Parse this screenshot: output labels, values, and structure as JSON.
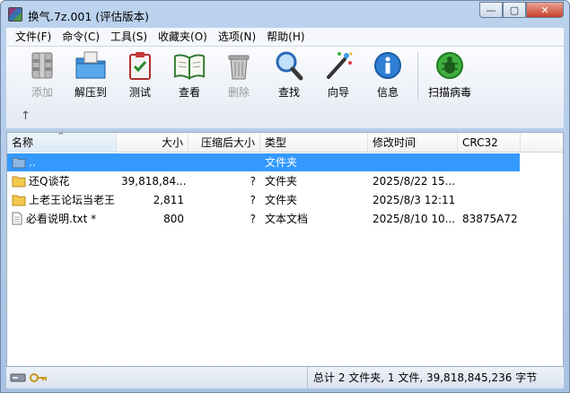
{
  "window": {
    "title": "换气.7z.001 (评估版本)",
    "buttons": {
      "minimize": "—",
      "maximize": "▢",
      "close": "✕"
    }
  },
  "menu": [
    "文件(F)",
    "命令(C)",
    "工具(S)",
    "收藏夹(O)",
    "选项(N)",
    "帮助(H)"
  ],
  "toolbar": {
    "add": "添加",
    "extract": "解压到",
    "test": "测试",
    "view": "查看",
    "delete": "删除",
    "find": "查找",
    "wizard": "向导",
    "info": "信息",
    "virus": "扫描病毒",
    "up_arrow": "↑"
  },
  "list": {
    "headers": {
      "name": "名称",
      "size": "大小",
      "packed": "压缩后大小",
      "type": "类型",
      "modified": "修改时间",
      "crc": "CRC32"
    },
    "sort_indicator": "^",
    "rows": [
      {
        "name": "..",
        "size": "",
        "packed": "",
        "type": "文件夹",
        "modified": "",
        "crc": "",
        "icon": "folder-up",
        "selected": true
      },
      {
        "name": "还Q谈花",
        "size": "39,818,84...",
        "packed": "?",
        "type": "文件夹",
        "modified": "2025/8/22 15...",
        "crc": "",
        "icon": "folder"
      },
      {
        "name": "上老王论坛当老王",
        "size": "2,811",
        "packed": "?",
        "type": "文件夹",
        "modified": "2025/8/3 12:11",
        "crc": "",
        "icon": "folder"
      },
      {
        "name": "必看说明.txt *",
        "size": "800",
        "packed": "?",
        "type": "文本文档",
        "modified": "2025/8/10 10...",
        "crc": "83875A72",
        "icon": "text-file"
      }
    ]
  },
  "status": {
    "summary": "总计 2 文件夹, 1 文件, 39,818,845,236 字节"
  }
}
